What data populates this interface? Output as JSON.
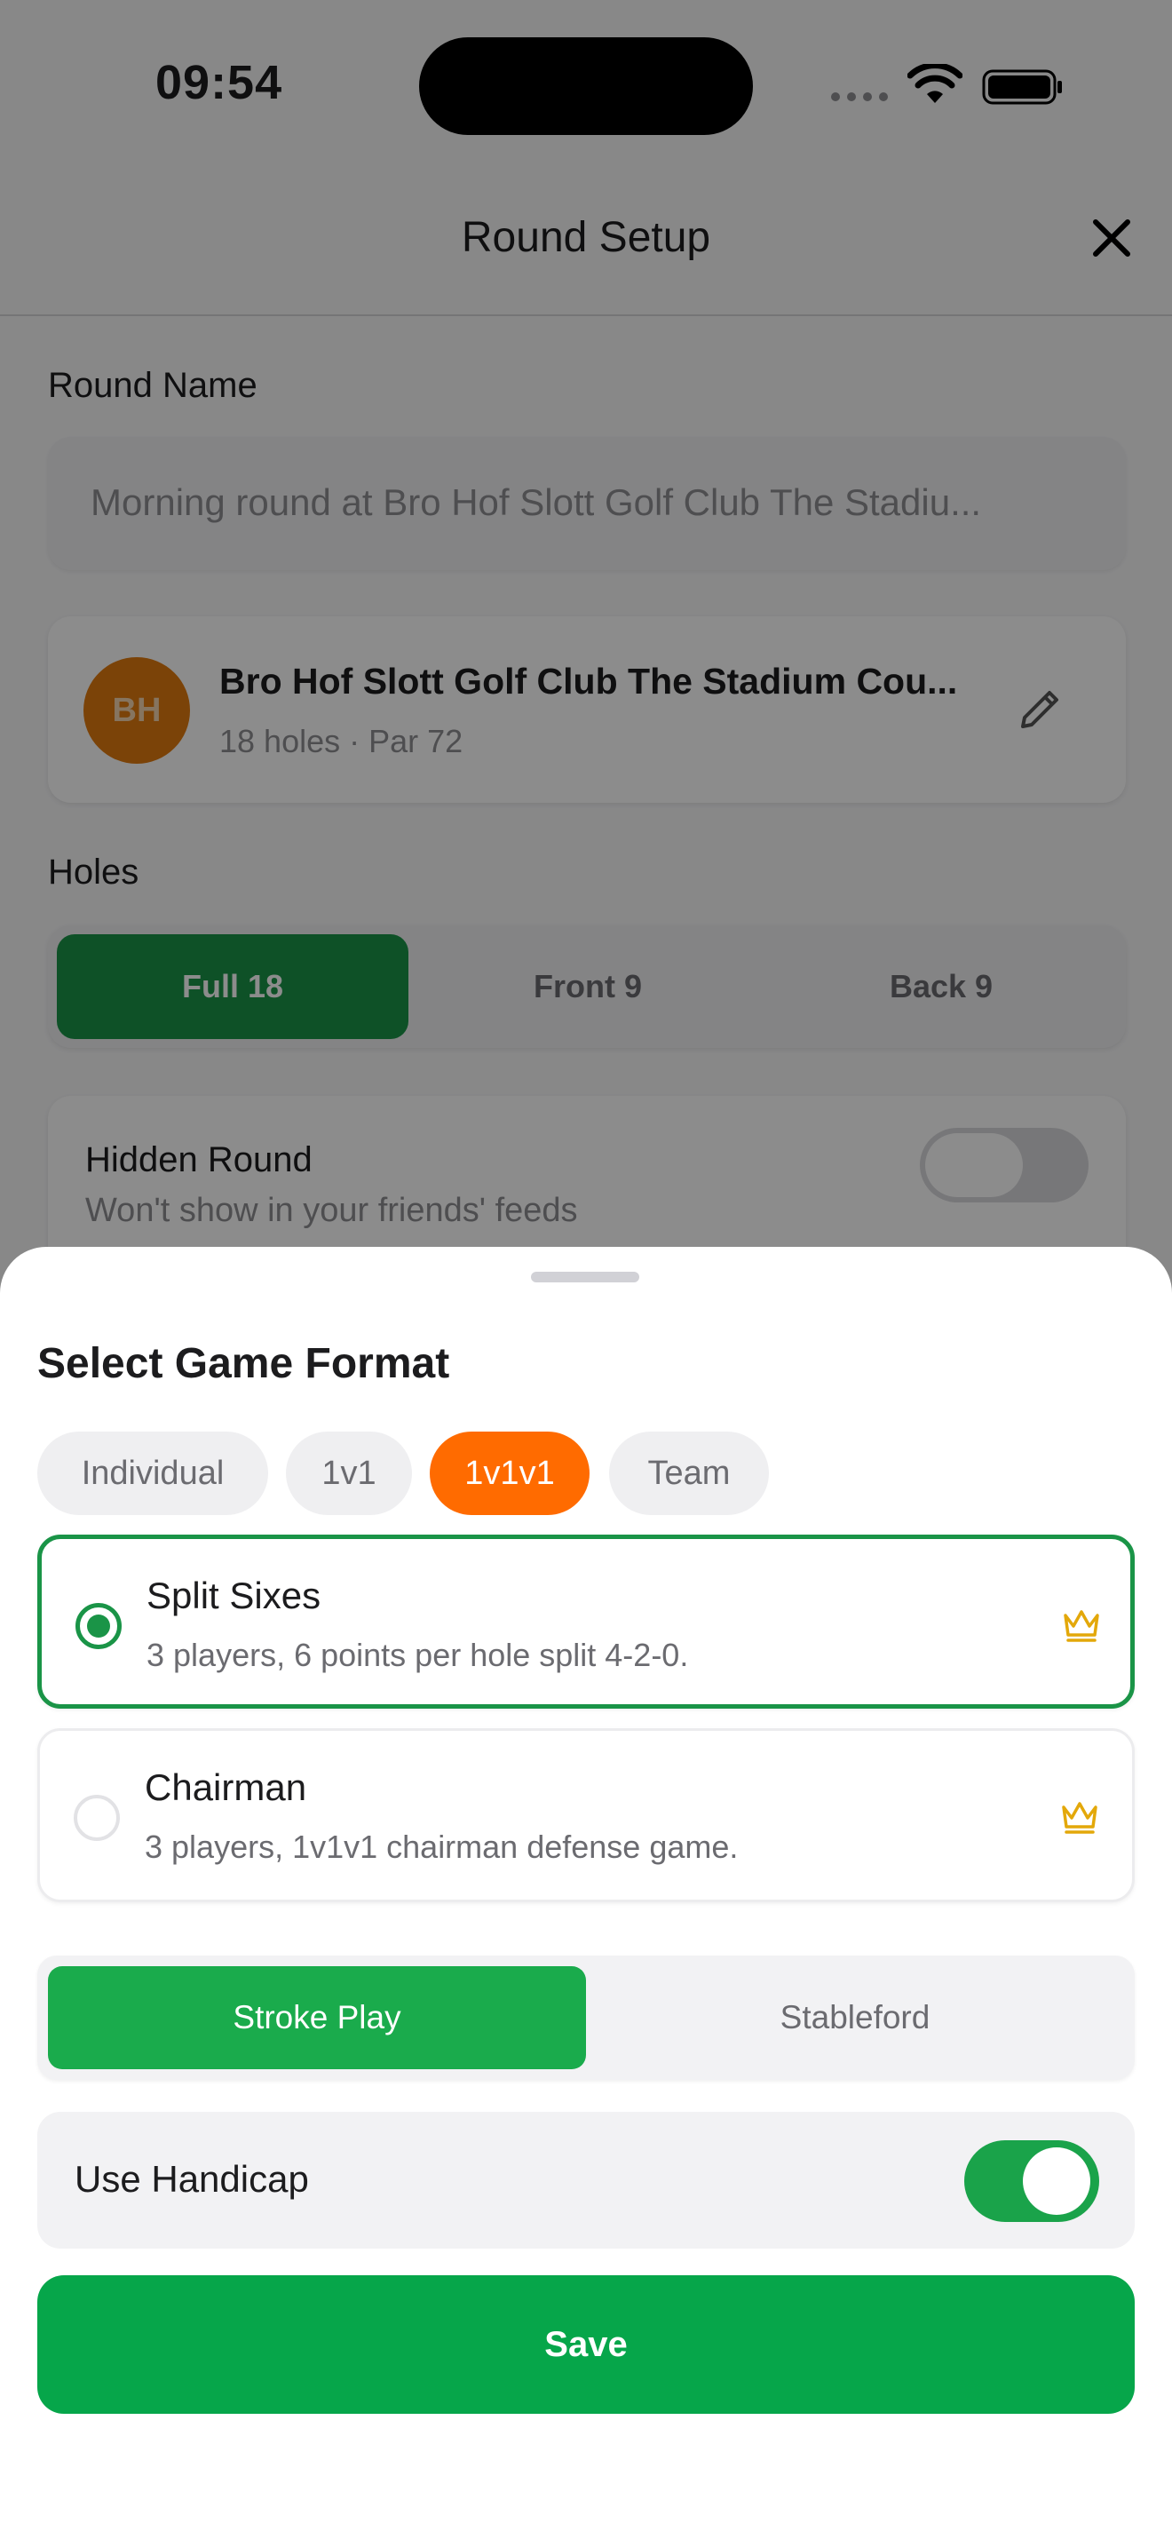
{
  "status_bar": {
    "time": "09:54"
  },
  "nav": {
    "title": "Round Setup"
  },
  "round_name": {
    "label": "Round Name",
    "placeholder": "Morning round at Bro Hof Slott Golf Club The Stadiu..."
  },
  "course": {
    "initials": "BH",
    "name": "Bro Hof Slott Golf Club The Stadium Cou...",
    "meta": "18 holes · Par 72",
    "avatar_color": "#e07a10"
  },
  "holes": {
    "label": "Holes",
    "options": [
      "Full 18",
      "Front 9",
      "Back 9"
    ],
    "selected": "Full 18"
  },
  "hidden_round": {
    "title": "Hidden Round",
    "subtitle": "Won't show in your friends' feeds",
    "enabled": false
  },
  "sheet": {
    "title": "Select Game Format",
    "categories": [
      "Individual",
      "1v1",
      "1v1v1",
      "Team"
    ],
    "selected_category": "1v1v1",
    "formats": [
      {
        "title": "Split Sixes",
        "description": "3 players, 6 points per hole split 4-2-0.",
        "selected": true,
        "icon": "crown-icon"
      },
      {
        "title": "Chairman",
        "description": "3 players, 1v1v1 chairman defense game.",
        "selected": false,
        "icon": "crown-icon"
      }
    ],
    "scoring": {
      "options": [
        "Stroke Play",
        "Stableford"
      ],
      "selected": "Stroke Play"
    },
    "handicap": {
      "label": "Use Handicap",
      "enabled": true
    },
    "save_label": "Save"
  },
  "colors": {
    "primary_green": "#1a9447",
    "accent_orange": "#ff6b00",
    "save_green": "#06a64a",
    "crown_gold": "#e3a80a"
  }
}
